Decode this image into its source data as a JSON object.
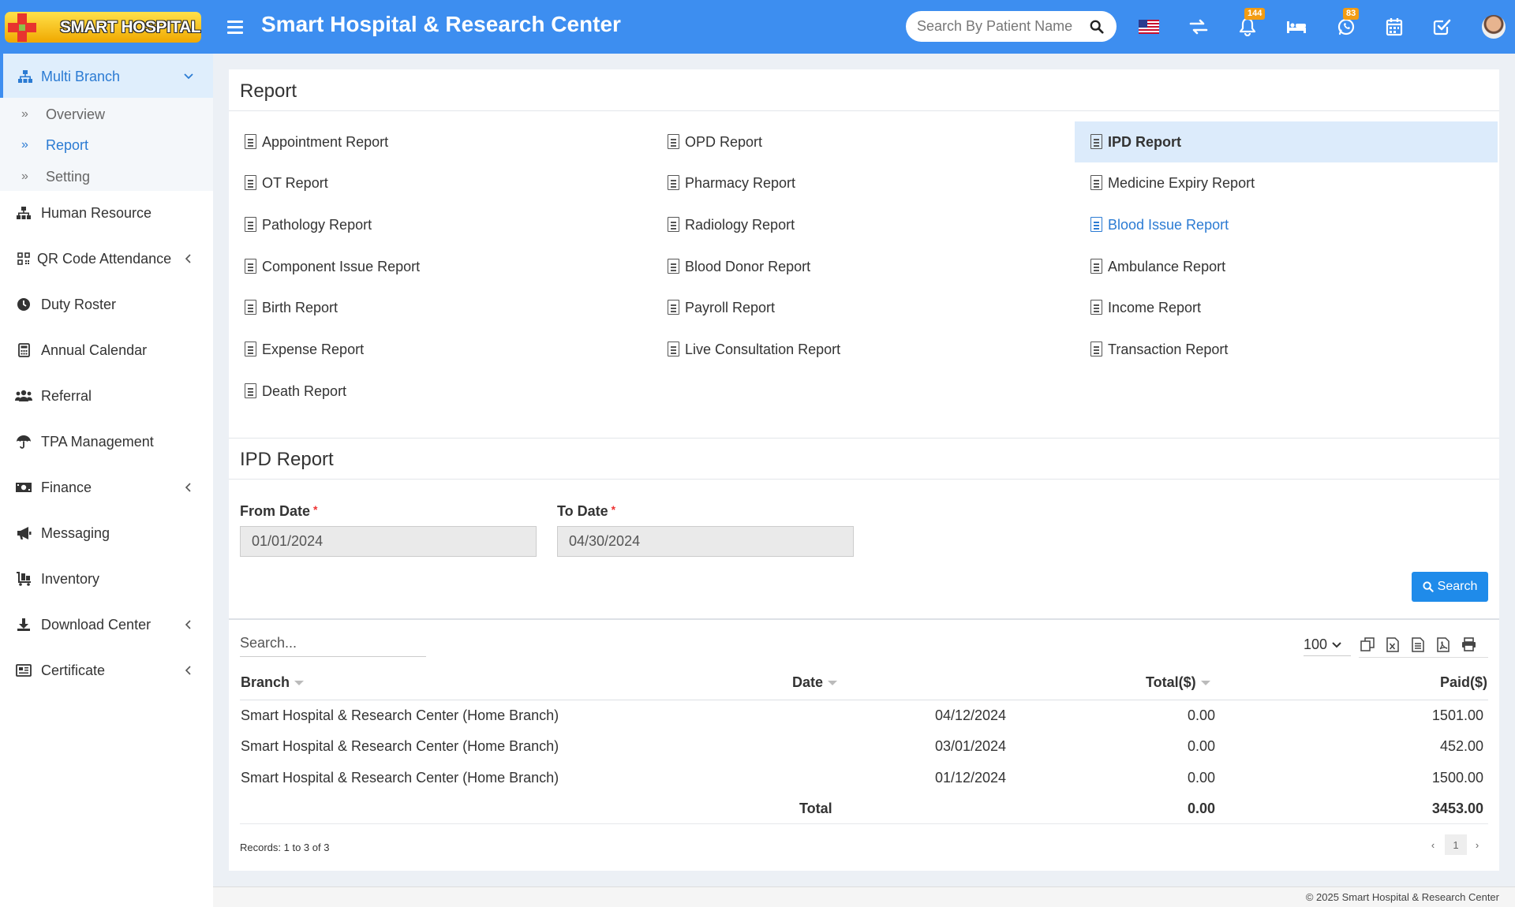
{
  "header": {
    "logo_text": "SMART HOSPITAL",
    "app_title": "Smart Hospital & Research Center",
    "search_placeholder": "Search By Patient Name",
    "notification_count": "144",
    "whatsapp_count": "83",
    "icons": [
      "menu-icon",
      "search-icon",
      "us-flag-icon",
      "switch-icon",
      "bell-icon",
      "bed-icon",
      "whatsapp-icon",
      "calendar-icon",
      "task-check-icon",
      "user-avatar"
    ],
    "accent_color": "#3d8ef0"
  },
  "sidebar": {
    "items": [
      {
        "label": "Multi Branch",
        "icon": "sitemap-icon",
        "active": true,
        "expanded": true
      },
      {
        "label": "Human Resource",
        "icon": "sitemap-icon"
      },
      {
        "label": "QR Code Attendance",
        "icon": "qrcode-icon",
        "has_children": true
      },
      {
        "label": "Duty Roster",
        "icon": "clock-icon"
      },
      {
        "label": "Annual Calendar",
        "icon": "calculator-icon"
      },
      {
        "label": "Referral",
        "icon": "users-icon"
      },
      {
        "label": "TPA Management",
        "icon": "umbrella-icon"
      },
      {
        "label": "Finance",
        "icon": "money-icon",
        "has_children": true
      },
      {
        "label": "Messaging",
        "icon": "bullhorn-icon"
      },
      {
        "label": "Inventory",
        "icon": "dolly-icon"
      },
      {
        "label": "Download Center",
        "icon": "download-icon",
        "has_children": true
      },
      {
        "label": "Certificate",
        "icon": "certificate-icon",
        "has_children": true
      }
    ],
    "sub_items": [
      {
        "label": "Overview"
      },
      {
        "label": "Report",
        "active": true
      },
      {
        "label": "Setting"
      }
    ]
  },
  "report": {
    "title": "Report",
    "links": [
      [
        "Appointment Report",
        "OPD Report",
        "IPD Report"
      ],
      [
        "OT Report",
        "Pharmacy Report",
        "Medicine Expiry Report"
      ],
      [
        "Pathology Report",
        "Radiology Report",
        "Blood Issue Report"
      ],
      [
        "Component Issue Report",
        "Blood Donor Report",
        "Ambulance Report"
      ],
      [
        "Birth Report",
        "Payroll Report",
        "Income Report"
      ],
      [
        "Expense Report",
        "Live Consultation Report",
        "Transaction Report"
      ],
      [
        "Death Report"
      ]
    ],
    "selected": "IPD Report",
    "hovered": "Blood Issue Report"
  },
  "ipd": {
    "title": "IPD Report",
    "from_label": "From Date",
    "to_label": "To Date",
    "required_mark": "*",
    "from_value": "01/01/2024",
    "to_value": "04/30/2024",
    "search_button": "Search"
  },
  "table": {
    "search_placeholder": "Search...",
    "page_size": "100",
    "export_icons": [
      "copy-icon",
      "excel-icon",
      "csv-icon",
      "pdf-icon",
      "print-icon"
    ],
    "headers": [
      "Branch",
      "Date",
      "Total($)",
      "Paid($)"
    ],
    "rows": [
      [
        "Smart Hospital & Research Center (Home Branch)",
        "04/12/2024",
        "0.00",
        "1501.00"
      ],
      [
        "Smart Hospital & Research Center (Home Branch)",
        "03/01/2024",
        "0.00",
        "452.00"
      ],
      [
        "Smart Hospital & Research Center (Home Branch)",
        "01/12/2024",
        "0.00",
        "1500.00"
      ]
    ],
    "total_label": "Total",
    "total_amount": "0.00",
    "total_paid": "3453.00",
    "records": "Records: 1 to 3 of 3",
    "prev": "‹",
    "page": "1",
    "next": "›"
  },
  "footer": {
    "copyright": "© 2025 Smart Hospital & Research Center"
  }
}
